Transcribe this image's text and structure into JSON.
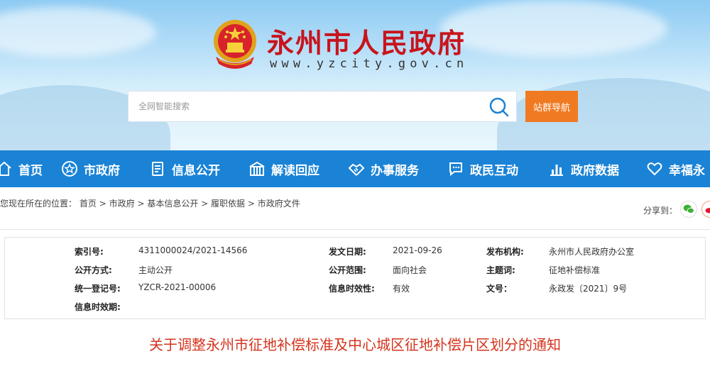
{
  "header": {
    "site_title": "永州市人民政府",
    "site_url": "www.yzcity.gov.cn",
    "search_placeholder": "全网智能搜索",
    "nav_sites_button": "站群导航"
  },
  "nav": [
    {
      "label": "首页",
      "icon": "home-icon"
    },
    {
      "label": "市政府",
      "icon": "star-badge-icon"
    },
    {
      "label": "信息公开",
      "icon": "document-icon"
    },
    {
      "label": "解读回应",
      "icon": "building-icon"
    },
    {
      "label": "办事服务",
      "icon": "handshake-icon"
    },
    {
      "label": "政民互动",
      "icon": "chat-icon"
    },
    {
      "label": "政府数据",
      "icon": "bar-chart-icon"
    },
    {
      "label": "幸福永",
      "icon": "heart-icon"
    }
  ],
  "breadcrumb": {
    "prefix": "您现在所在的位置：",
    "items": [
      "首页",
      "市政府",
      "基本信息公开",
      "履职依据",
      "市政府文件"
    ],
    "separator": ">"
  },
  "share": {
    "label": "分享到："
  },
  "info": {
    "index_no": {
      "label": "索引号:",
      "value": "4311000024/2021-14566"
    },
    "issue_date": {
      "label": "发文日期:",
      "value": "2021-09-26"
    },
    "publisher": {
      "label": "发布机构:",
      "value": "永州市人民政府办公室"
    },
    "open_mode": {
      "label": "公开方式:",
      "value": "主动公开"
    },
    "open_scope": {
      "label": "公开范围:",
      "value": "面向社会"
    },
    "subject": {
      "label": "主题词:",
      "value": "征地补偿标准"
    },
    "reg_no": {
      "label": "统一登记号:",
      "value": "YZCR-2021-00006"
    },
    "validity": {
      "label": "信息时效性:",
      "value": "有效"
    },
    "doc_no": {
      "label": "文号：",
      "value": "永政发〔2021〕9号"
    },
    "invalid_date": {
      "label": "信息时效期:",
      "value": ""
    }
  },
  "document": {
    "title": "关于调整永州市征地补偿标准及中心城区征地补偿片区划分的通知"
  },
  "colors": {
    "brand_red": "#c8141c",
    "nav_blue": "#1a83d6",
    "accent_orange": "#f07a22",
    "title_red": "#d4331c"
  }
}
